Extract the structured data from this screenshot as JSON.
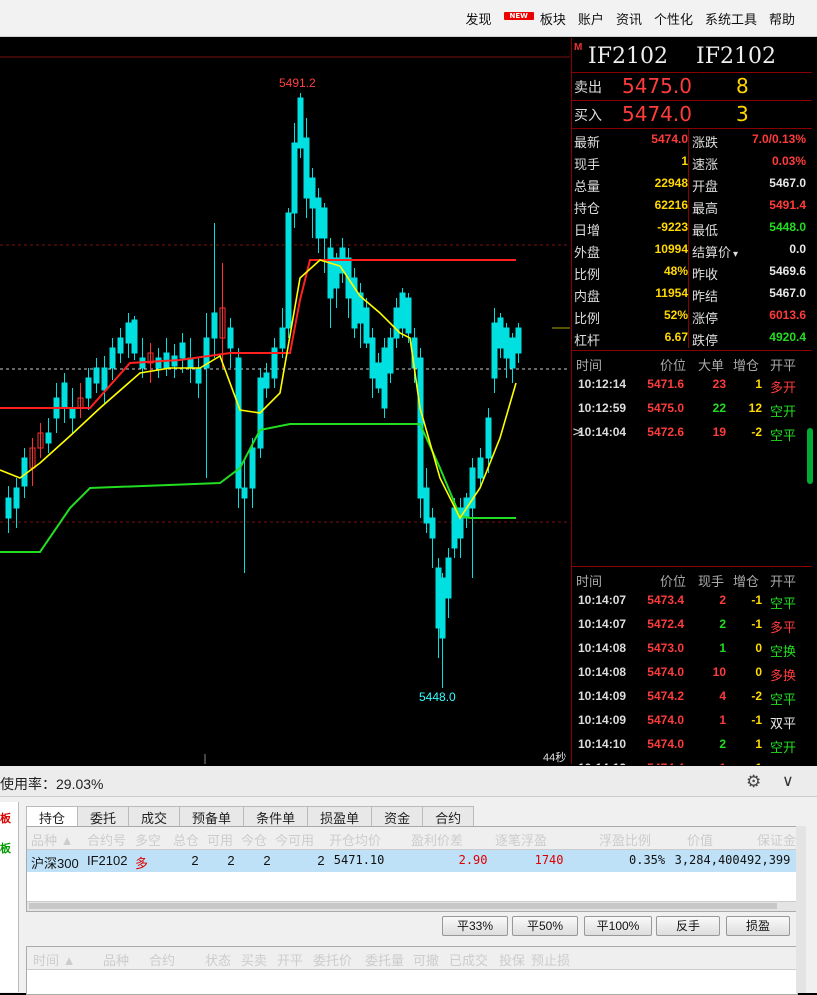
{
  "menu": {
    "items": [
      "发现",
      "板块",
      "账户",
      "资讯",
      "个性化",
      "系统工具",
      "帮助"
    ],
    "new_badge": "NEW"
  },
  "chart": {
    "high_label": "5491.2",
    "low_label": "5448.0",
    "time_label": "44秒",
    "colors": {
      "up": "#ff3030",
      "down": "#00e0e0",
      "ma_yellow": "#ffff00",
      "ma_green": "#22dd22",
      "ma_red": "#ff2020"
    }
  },
  "quote": {
    "marker": "M",
    "symbol": "IF2102",
    "name": "IF2102",
    "ask": {
      "label": "卖出",
      "price": "5475.0",
      "volume": "8"
    },
    "bid": {
      "label": "买入",
      "price": "5474.0",
      "volume": "3"
    },
    "rows": [
      {
        "l1": "最新",
        "v1": "5474.0",
        "c1": "#ff3b3b",
        "l2": "涨跌",
        "v2": "7.0/0.13%",
        "c2": "#ff3b3b"
      },
      {
        "l1": "现手",
        "v1": "1",
        "c1": "#ffd800",
        "l2": "速涨",
        "v2": "0.03%",
        "c2": "#ff3b3b"
      },
      {
        "l1": "总量",
        "v1": "22948",
        "c1": "#ffd800",
        "l2": "开盘",
        "v2": "5467.0",
        "c2": "#e8e8e8"
      },
      {
        "l1": "持仓",
        "v1": "62216",
        "c1": "#ffd800",
        "l2": "最高",
        "v2": "5491.4",
        "c2": "#ff3b3b"
      },
      {
        "l1": "日增",
        "v1": "-9223",
        "c1": "#ffd800",
        "l2": "最低",
        "v2": "5448.0",
        "c2": "#22dd22"
      },
      {
        "l1": "外盘",
        "v1": "10994",
        "c1": "#ffd800",
        "l2": "结算价",
        "v2": "0.0",
        "c2": "#e8e8e8"
      },
      {
        "l1": "比例",
        "v1": "48%",
        "c1": "#ffd800",
        "l2": "昨收",
        "v2": "5469.6",
        "c2": "#e8e8e8"
      },
      {
        "l1": "内盘",
        "v1": "11954",
        "c1": "#ffd800",
        "l2": "昨结",
        "v2": "5467.0",
        "c2": "#e8e8e8"
      },
      {
        "l1": "比例",
        "v1": "52%",
        "c1": "#ffd800",
        "l2": "涨停",
        "v2": "6013.6",
        "c2": "#ff3b3b"
      },
      {
        "l1": "杠杆",
        "v1": "6.67",
        "c1": "#ffd800",
        "l2": "跌停",
        "v2": "4920.4",
        "c2": "#22dd22"
      }
    ],
    "settle_arrow": "▾"
  },
  "big_ticks": {
    "headers": [
      "时间",
      "价位",
      "大单",
      "增仓",
      "开平"
    ],
    "rows": [
      {
        "time": "10:12:14",
        "price": "5471.6",
        "vol": "23",
        "vc": "#ff3b3b",
        "chg": "1",
        "type": "多开",
        "tc": "#ff3b3b",
        "mark": ""
      },
      {
        "time": "10:12:59",
        "price": "5475.0",
        "vol": "22",
        "vc": "#22dd22",
        "chg": "12",
        "type": "空开",
        "tc": "#22dd22",
        "mark": ""
      },
      {
        "time": "10:14:04",
        "price": "5472.6",
        "vol": "19",
        "vc": "#ff3b3b",
        "chg": "-2",
        "type": "空平",
        "tc": "#22dd22",
        "mark": ">"
      }
    ]
  },
  "ticks": {
    "headers": [
      "时间",
      "价位",
      "现手",
      "增仓",
      "开平"
    ],
    "rows": [
      {
        "time": "10:14:07",
        "price": "5473.4",
        "vol": "2",
        "vc": "#ff3b3b",
        "chg": "-1",
        "type": "空平",
        "tc": "#22dd22"
      },
      {
        "time": "10:14:07",
        "price": "5472.4",
        "vol": "2",
        "vc": "#22dd22",
        "chg": "-1",
        "type": "多平",
        "tc": "#ff3b3b"
      },
      {
        "time": "10:14:08",
        "price": "5473.0",
        "vol": "1",
        "vc": "#22dd22",
        "chg": "0",
        "type": "空换",
        "tc": "#22dd22"
      },
      {
        "time": "10:14:08",
        "price": "5474.0",
        "vol": "10",
        "vc": "#ff3b3b",
        "chg": "0",
        "type": "多换",
        "tc": "#ff3b3b"
      },
      {
        "time": "10:14:09",
        "price": "5474.2",
        "vol": "4",
        "vc": "#ff3b3b",
        "chg": "-2",
        "type": "空平",
        "tc": "#22dd22"
      },
      {
        "time": "10:14:09",
        "price": "5474.0",
        "vol": "1",
        "vc": "#ff3b3b",
        "chg": "-1",
        "type": "双平",
        "tc": "#e8e8e8"
      },
      {
        "time": "10:14:10",
        "price": "5474.0",
        "vol": "2",
        "vc": "#22dd22",
        "chg": "1",
        "type": "空开",
        "tc": "#22dd22"
      },
      {
        "time": "10:14:12",
        "price": "5474.4",
        "vol": "1",
        "vc": "#ff3b3b",
        "chg": "1",
        "type": "空开",
        "tc": "#22dd22"
      }
    ]
  },
  "bottom": {
    "usage": "使用率：29.03%",
    "side_labels": [
      "板",
      "板"
    ],
    "tabs": [
      "持仓",
      "委托",
      "成交",
      "预备单",
      "条件单",
      "损盈单",
      "资金",
      "合约"
    ],
    "pos_headers": [
      "品种 ▲",
      "合约号",
      "多空",
      "总仓",
      "可用",
      "今仓",
      "今可用",
      "开仓均价",
      "盈利价差",
      "逐笔浮盈",
      "浮盈比例",
      "价值",
      "保证金"
    ],
    "pos_row": [
      "沪深300",
      "IF2102",
      "多",
      "2",
      "2",
      "2",
      "2",
      "5471.10",
      "2.90",
      "1740",
      "0.35%",
      "3,284,400",
      "492,399"
    ],
    "buttons": [
      "平33%",
      "平50%",
      "平100%",
      "反手",
      "损盈"
    ],
    "order_headers": [
      "时间 ▲",
      "品种",
      "合约",
      "状态",
      "买卖",
      "开平",
      "委托价",
      "委托量",
      "可撤",
      "已成交",
      "投保",
      "预止损"
    ]
  }
}
